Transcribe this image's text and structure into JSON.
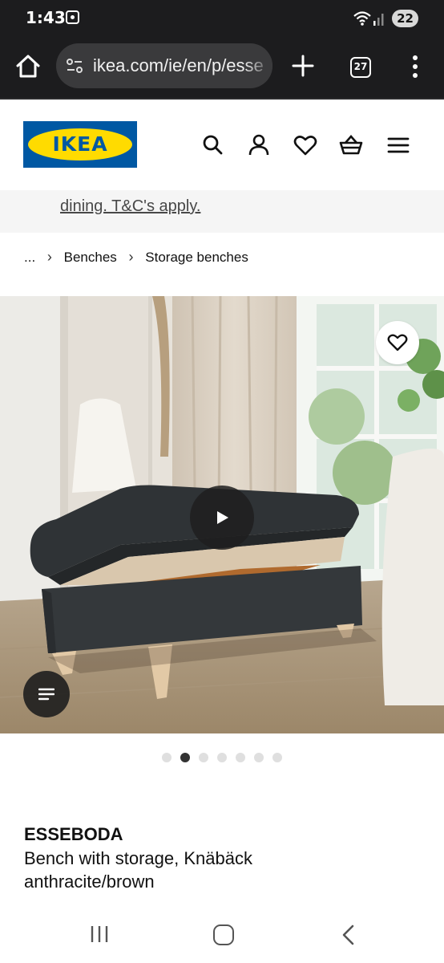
{
  "status_bar": {
    "time": "1:43",
    "battery": "22",
    "icons": [
      "screen-record-icon",
      "wifi-icon",
      "signal-icon"
    ]
  },
  "browser": {
    "url": "ikea.com/ie/en/p/esse",
    "tab_count": "27",
    "icons": [
      "home-icon",
      "site-settings-icon",
      "new-tab-icon",
      "tab-switcher-icon",
      "more-menu-icon"
    ]
  },
  "header": {
    "logo_text": "IKEA",
    "icons": [
      "search-icon",
      "account-icon",
      "favourites-icon",
      "basket-icon",
      "menu-icon"
    ]
  },
  "promo": {
    "text": "dining. T&C's apply."
  },
  "breadcrumb": {
    "items": [
      "...",
      "Benches",
      "Storage benches"
    ]
  },
  "gallery": {
    "slide_count": 7,
    "active_slide": 2,
    "icons": [
      "heart-icon",
      "play-icon",
      "list-icon"
    ]
  },
  "product": {
    "name": "ESSEBODA",
    "description": "Bench with storage, Knäbäck anthracite/brown"
  },
  "colors": {
    "ikea_blue": "#0058a3",
    "ikea_yellow": "#ffdb00",
    "browser_bar": "#1c1c1e"
  }
}
